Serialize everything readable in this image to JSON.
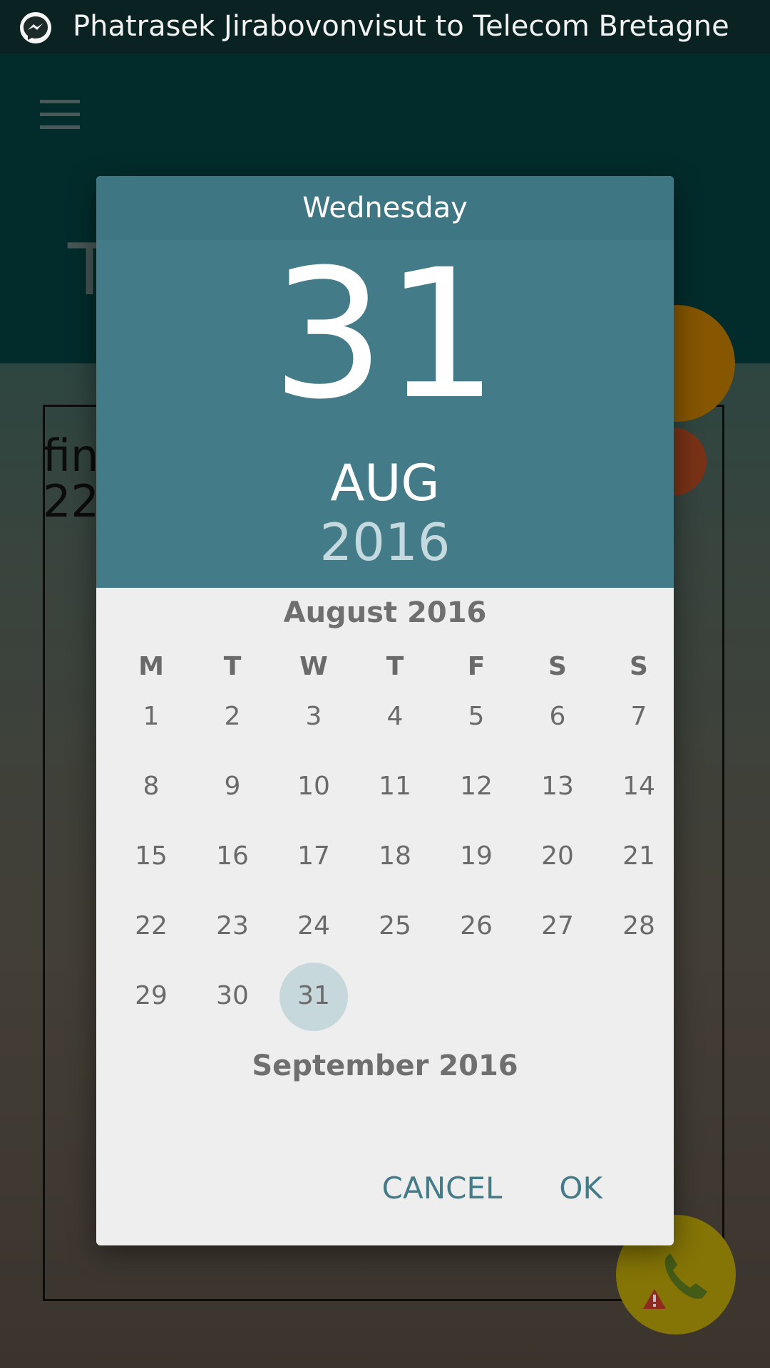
{
  "notification": {
    "title": "Phatrasek Jirabovonvisut to Telecom Bretagne",
    "icon": "messenger-icon"
  },
  "background": {
    "title_letter": "T",
    "text_line1": "fin",
    "text_line2": "22"
  },
  "dialog": {
    "day_of_week": "Wednesday",
    "day": "31",
    "month": "AUG",
    "year": "2016",
    "month_title": "August 2016",
    "next_month_title": "September 2016",
    "weekdays": [
      "M",
      "T",
      "W",
      "T",
      "F",
      "S",
      "S"
    ],
    "weeks": [
      [
        "1",
        "2",
        "3",
        "4",
        "5",
        "6",
        "7"
      ],
      [
        "8",
        "9",
        "10",
        "11",
        "12",
        "13",
        "14"
      ],
      [
        "15",
        "16",
        "17",
        "18",
        "19",
        "20",
        "21"
      ],
      [
        "22",
        "23",
        "24",
        "25",
        "26",
        "27",
        "28"
      ],
      [
        "29",
        "30",
        "31",
        "",
        "",
        "",
        ""
      ]
    ],
    "selected_day": "31",
    "cancel_label": "CANCEL",
    "ok_label": "OK"
  },
  "colors": {
    "header_dark": "#3f7684",
    "header": "#437b89",
    "selection": "#c6d8dc",
    "button_text": "#437b89"
  }
}
